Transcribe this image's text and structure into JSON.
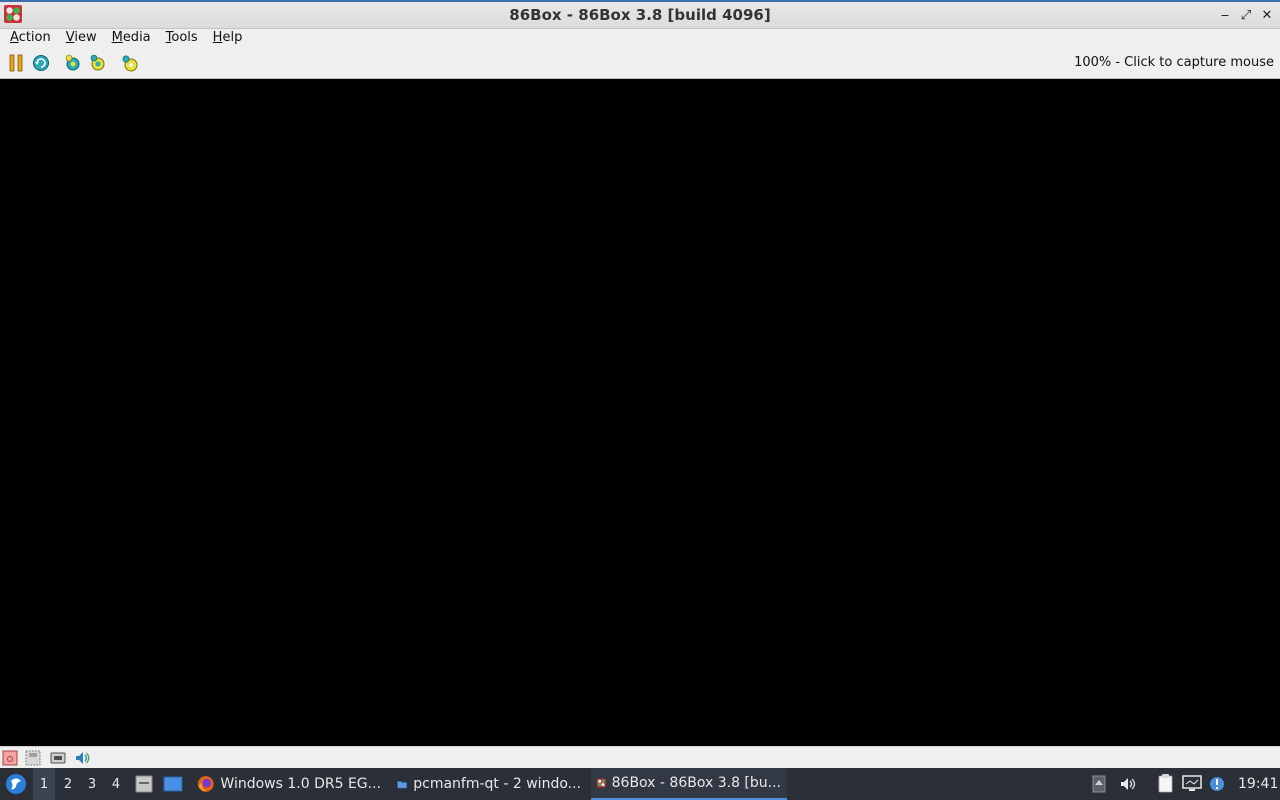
{
  "window": {
    "title": "86Box - 86Box 3.8 [build 4096]",
    "minimize_glyph": "‒",
    "maximize_glyph": "⤢",
    "close_glyph": "✕"
  },
  "menubar": {
    "items": [
      {
        "label_u": "A",
        "label_rest": "ction"
      },
      {
        "label_u": "V",
        "label_rest": "iew"
      },
      {
        "label_u": "M",
        "label_rest": "edia"
      },
      {
        "label_u": "T",
        "label_rest": "ools"
      },
      {
        "label_u": "H",
        "label_rest": "elp"
      }
    ]
  },
  "toolbar": {
    "buttons": [
      "pause-icon",
      "hard-reset-icon",
      "ctrl-alt-del-icon",
      "ctrl-alt-esc-icon",
      "settings-icon"
    ],
    "status": "100% - Click to capture mouse"
  },
  "statusbar": {
    "icons": [
      "hdd-icon",
      "floppy-icon",
      "network-icon",
      "sound-icon"
    ]
  },
  "taskbar": {
    "desktops": [
      "1",
      "2",
      "3",
      "4"
    ],
    "active_desktop": "1",
    "tasks": [
      {
        "label": "Windows 1.0 DR5 EG...",
        "icon": "firefox-icon"
      },
      {
        "label": "pcmanfm-qt - 2 windo...",
        "icon": "folder-icon"
      },
      {
        "label": "86Box - 86Box 3.8 [bu...",
        "icon": "86box-icon",
        "active": true
      }
    ],
    "clock": "19:41"
  },
  "colors": {
    "taskbar_bg": "#2b3038",
    "accent": "#4a8fd8",
    "screen_bg": "#000000"
  }
}
